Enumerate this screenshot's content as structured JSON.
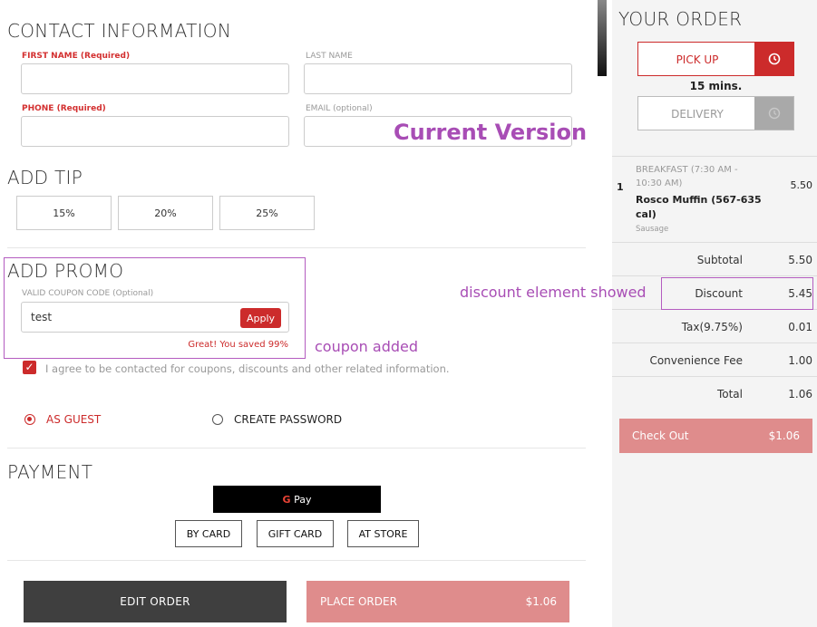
{
  "contact": {
    "heading": "CONTACT INFORMATION",
    "first_name_label": "FIRST NAME (Required)",
    "last_name_label": "LAST NAME",
    "phone_label": "PHONE (Required)",
    "email_label": "EMAIL (optional)",
    "first_name_value": "",
    "last_name_value": "",
    "phone_value": "",
    "email_value": ""
  },
  "tip": {
    "heading": "ADD TIP",
    "options": [
      "15%",
      "20%",
      "25%"
    ]
  },
  "promo": {
    "heading": "ADD PROMO",
    "coupon_label": "VALID COUPON CODE (Optional)",
    "coupon_value": "test",
    "apply_label": "Apply",
    "success_message": "Great! You saved 99%"
  },
  "consent": {
    "checked": true,
    "text": "I agree to be contacted for coupons, discounts and other related information."
  },
  "account": {
    "guest_label": "AS GUEST",
    "create_password_label": "CREATE PASSWORD",
    "selected": "guest"
  },
  "payment": {
    "heading": "PAYMENT",
    "gpay_g": "G",
    "gpay_text": "Pay",
    "methods": [
      "BY CARD",
      "GIFT CARD",
      "AT STORE"
    ]
  },
  "actions": {
    "edit_order_label": "EDIT ORDER",
    "place_order_label": "PLACE ORDER",
    "place_order_amount": "$1.06"
  },
  "order": {
    "heading": "YOUR ORDER",
    "pickup_label": "PICK UP",
    "pickup_time": "15 mins.",
    "delivery_label": "DELIVERY",
    "item": {
      "qty": "1",
      "category_line1": "BREAKFAST (7:30 AM -",
      "category_line2": "10:30 AM)",
      "name_line1": "Rosco Muffin (567-635",
      "name_line2": "cal)",
      "modifier": "Sausage",
      "price": "5.50"
    },
    "summary": [
      {
        "label": "Subtotal",
        "value": "5.50"
      },
      {
        "label": "Discount",
        "value": "5.45"
      },
      {
        "label": "Tax(9.75%)",
        "value": "0.01"
      },
      {
        "label": "Convenience Fee",
        "value": "1.00"
      },
      {
        "label": "Total",
        "value": "1.06"
      }
    ],
    "checkout_label": "Check Out",
    "checkout_amount": "$1.06"
  },
  "annotations": {
    "title": "Current Version",
    "coupon_note": "coupon added",
    "discount_note": "discount element showed",
    "color": "#a84db5"
  },
  "colors": {
    "accent": "#cc2b2b",
    "accent_muted": "#df8c8c",
    "dark_button": "#3f3f3f"
  }
}
